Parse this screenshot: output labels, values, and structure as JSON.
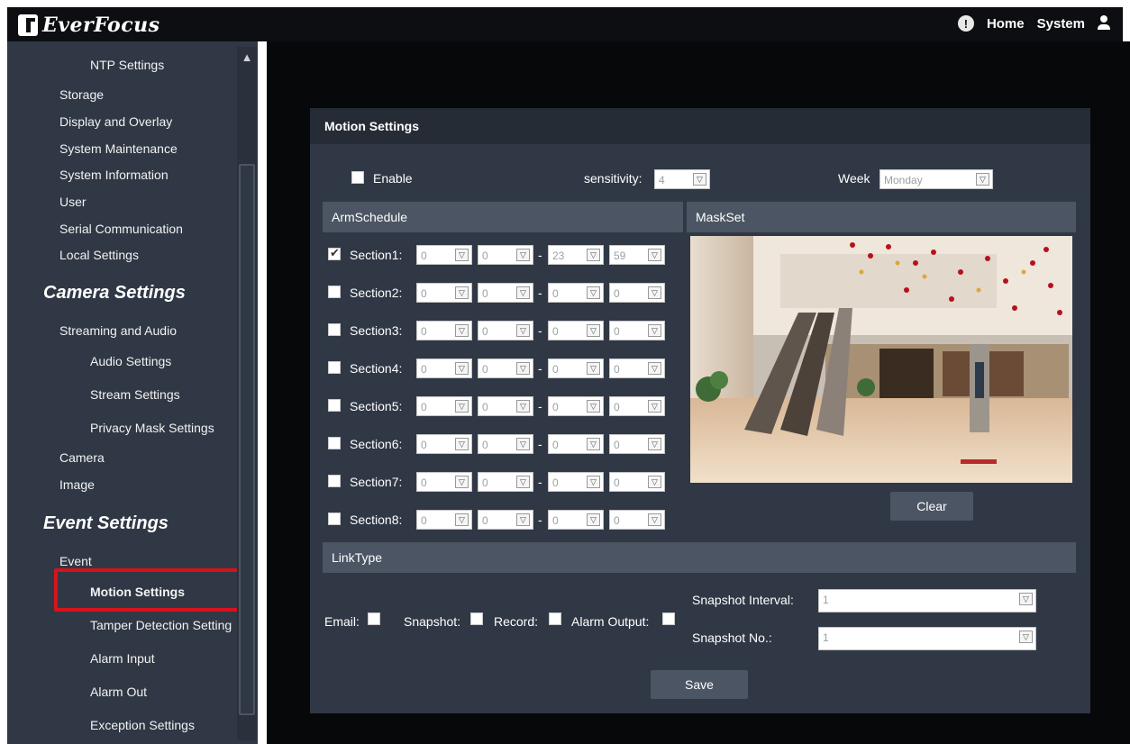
{
  "brand": {
    "name": "EverFocus"
  },
  "topnav": {
    "home": "Home",
    "system": "System"
  },
  "sidebar": {
    "items": [
      {
        "label": "NTP Settings"
      },
      {
        "label": "Storage"
      },
      {
        "label": "Display and Overlay"
      },
      {
        "label": "System Maintenance"
      },
      {
        "label": "System Information"
      },
      {
        "label": "User"
      },
      {
        "label": "Serial Communication"
      },
      {
        "label": "Local Settings"
      }
    ],
    "camera_heading": "Camera Settings",
    "camera_items": [
      {
        "label": "Streaming and Audio"
      },
      {
        "label": "Audio Settings"
      },
      {
        "label": "Stream Settings"
      },
      {
        "label": "Privacy Mask Settings"
      },
      {
        "label": "Camera"
      },
      {
        "label": "Image"
      }
    ],
    "event_heading": "Event Settings",
    "event_items": [
      {
        "label": "Event"
      },
      {
        "label": "Motion Settings"
      },
      {
        "label": "Tamper Detection Setting"
      },
      {
        "label": "Alarm Input"
      },
      {
        "label": "Alarm Out"
      },
      {
        "label": "Exception Settings"
      }
    ]
  },
  "panel": {
    "title": "Motion Settings",
    "enable_label": "Enable",
    "enable_checked": false,
    "sensitivity_label": "sensitivity:",
    "sensitivity_value": "4",
    "week_label": "Week",
    "week_value": "Monday",
    "armschedule_label": "ArmSchedule",
    "maskset_label": "MaskSet",
    "sections": [
      {
        "label": "Section1:",
        "checked": true,
        "h1": "0",
        "m1": "0",
        "h2": "23",
        "m2": "59"
      },
      {
        "label": "Section2:",
        "checked": false,
        "h1": "0",
        "m1": "0",
        "h2": "0",
        "m2": "0"
      },
      {
        "label": "Section3:",
        "checked": false,
        "h1": "0",
        "m1": "0",
        "h2": "0",
        "m2": "0"
      },
      {
        "label": "Section4:",
        "checked": false,
        "h1": "0",
        "m1": "0",
        "h2": "0",
        "m2": "0"
      },
      {
        "label": "Section5:",
        "checked": false,
        "h1": "0",
        "m1": "0",
        "h2": "0",
        "m2": "0"
      },
      {
        "label": "Section6:",
        "checked": false,
        "h1": "0",
        "m1": "0",
        "h2": "0",
        "m2": "0"
      },
      {
        "label": "Section7:",
        "checked": false,
        "h1": "0",
        "m1": "0",
        "h2": "0",
        "m2": "0"
      },
      {
        "label": "Section8:",
        "checked": false,
        "h1": "0",
        "m1": "0",
        "h2": "0",
        "m2": "0"
      }
    ],
    "dash": "-",
    "clear_label": "Clear",
    "linktype_label": "LinkType",
    "email_label": "Email:",
    "snapshot_label": "Snapshot:",
    "record_label": "Record:",
    "alarm_output_label": "Alarm Output:",
    "snapshot_interval_label": "Snapshot Interval:",
    "snapshot_interval_value": "1",
    "snapshot_no_label": "Snapshot No.:",
    "snapshot_no_value": "1",
    "save_label": "Save"
  },
  "colors": {
    "topbar": "#0c0e12",
    "sidebar": "#303845",
    "panel": "#303845",
    "strip": "#4c5563",
    "highlight": "#d8121a"
  }
}
